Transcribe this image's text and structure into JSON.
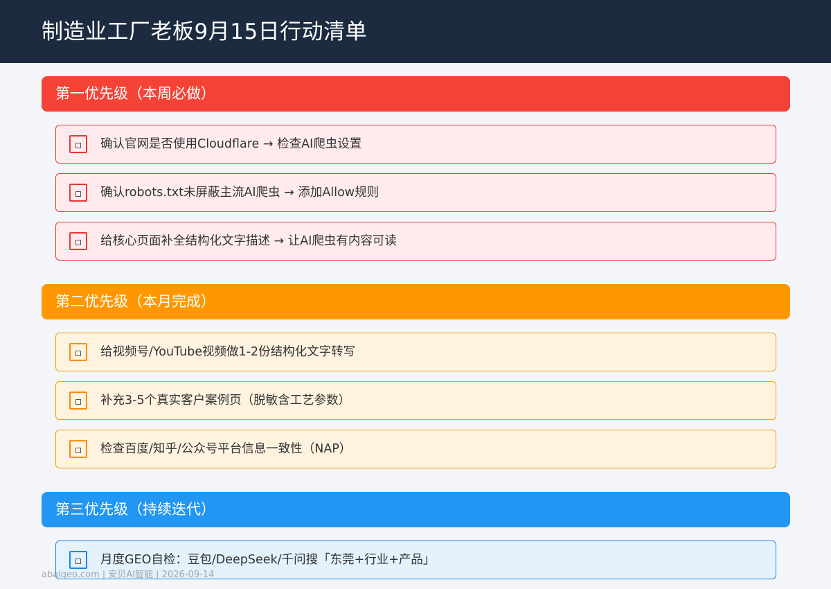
{
  "header": {
    "title": "制造业工厂老板9月15日行动清单"
  },
  "sections": [
    {
      "title": "第一优先级（本周必做）",
      "color": "#f44336",
      "tasks": [
        {
          "text": "确认官网是否使用Cloudflare → 检查AI爬虫设置",
          "checked": false
        },
        {
          "text": "确认robots.txt未屏蔽主流AI爬虫 → 添加Allow规则",
          "checked": false
        },
        {
          "text": "给核心页面补全结构化文字描述 → 让AI爬虫有内容可读",
          "checked": false
        }
      ]
    },
    {
      "title": "第二优先级（本月完成）",
      "color": "#ff9800",
      "tasks": [
        {
          "text": "给视频号/YouTube视频做1-2份结构化文字转写",
          "checked": false
        },
        {
          "text": "补充3-5个真实客户案例页（脱敏含工艺参数）",
          "checked": false
        },
        {
          "text": "检查百度/知乎/公众号平台信息一致性（NAP）",
          "checked": false
        }
      ]
    },
    {
      "title": "第三优先级（持续迭代）",
      "color": "#2196f3",
      "tasks": [
        {
          "text": "月度GEO自检：豆包/DeepSeek/千问搜「东莞+行业+产品」",
          "checked": false
        }
      ]
    }
  ],
  "footer": {
    "text": "abaigeo.com | 安贝AI智能 | 2026-09-14"
  }
}
